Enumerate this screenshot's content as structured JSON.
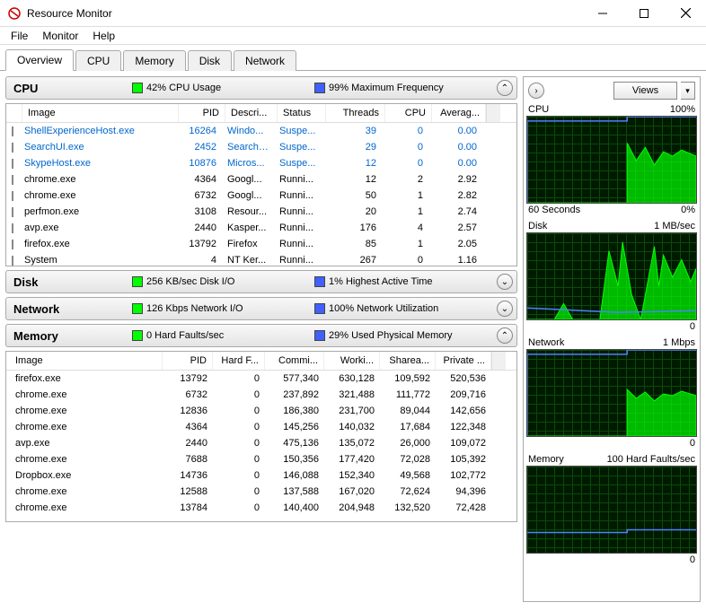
{
  "window": {
    "title": "Resource Monitor"
  },
  "menu": [
    "File",
    "Monitor",
    "Help"
  ],
  "tabs": [
    "Overview",
    "CPU",
    "Memory",
    "Disk",
    "Network"
  ],
  "active_tab": 0,
  "sections": {
    "cpu": {
      "name": "CPU",
      "stat1": "42% CPU Usage",
      "stat2": "99% Maximum Frequency",
      "expanded": true,
      "headers": [
        "Image",
        "PID",
        "Descri...",
        "Status",
        "Threads",
        "CPU",
        "Averag..."
      ],
      "rows": [
        {
          "blue": true,
          "img": "ShellExperienceHost.exe",
          "pid": "16264",
          "desc": "Windo...",
          "status": "Suspe...",
          "threads": "39",
          "cpu": "0",
          "avg": "0.00"
        },
        {
          "blue": true,
          "img": "SearchUI.exe",
          "pid": "2452",
          "desc": "Search ...",
          "status": "Suspe...",
          "threads": "29",
          "cpu": "0",
          "avg": "0.00"
        },
        {
          "blue": true,
          "img": "SkypeHost.exe",
          "pid": "10876",
          "desc": "Micros...",
          "status": "Suspe...",
          "threads": "12",
          "cpu": "0",
          "avg": "0.00"
        },
        {
          "blue": false,
          "img": "chrome.exe",
          "pid": "4364",
          "desc": "Googl...",
          "status": "Runni...",
          "threads": "12",
          "cpu": "2",
          "avg": "2.92"
        },
        {
          "blue": false,
          "img": "chrome.exe",
          "pid": "6732",
          "desc": "Googl...",
          "status": "Runni...",
          "threads": "50",
          "cpu": "1",
          "avg": "2.82"
        },
        {
          "blue": false,
          "img": "perfmon.exe",
          "pid": "3108",
          "desc": "Resour...",
          "status": "Runni...",
          "threads": "20",
          "cpu": "1",
          "avg": "2.74"
        },
        {
          "blue": false,
          "img": "avp.exe",
          "pid": "2440",
          "desc": "Kasper...",
          "status": "Runni...",
          "threads": "176",
          "cpu": "4",
          "avg": "2.57"
        },
        {
          "blue": false,
          "img": "firefox.exe",
          "pid": "13792",
          "desc": "Firefox",
          "status": "Runni...",
          "threads": "85",
          "cpu": "1",
          "avg": "2.05"
        },
        {
          "blue": false,
          "img": "System",
          "pid": "4",
          "desc": "NT Ker...",
          "status": "Runni...",
          "threads": "267",
          "cpu": "0",
          "avg": "1.16"
        }
      ]
    },
    "disk": {
      "name": "Disk",
      "stat1": "256 KB/sec Disk I/O",
      "stat2": "1% Highest Active Time",
      "expanded": false
    },
    "network": {
      "name": "Network",
      "stat1": "126 Kbps Network I/O",
      "stat2": "100% Network Utilization",
      "expanded": false
    },
    "memory": {
      "name": "Memory",
      "stat1": "0 Hard Faults/sec",
      "stat2": "29% Used Physical Memory",
      "expanded": true,
      "headers": [
        "Image",
        "PID",
        "Hard F...",
        "Commi...",
        "Worki...",
        "Sharea...",
        "Private ..."
      ],
      "rows": [
        {
          "img": "firefox.exe",
          "pid": "13792",
          "hf": "0",
          "commit": "577,340",
          "work": "630,128",
          "share": "109,592",
          "priv": "520,536"
        },
        {
          "img": "chrome.exe",
          "pid": "6732",
          "hf": "0",
          "commit": "237,892",
          "work": "321,488",
          "share": "111,772",
          "priv": "209,716"
        },
        {
          "img": "chrome.exe",
          "pid": "12836",
          "hf": "0",
          "commit": "186,380",
          "work": "231,700",
          "share": "89,044",
          "priv": "142,656"
        },
        {
          "img": "chrome.exe",
          "pid": "4364",
          "hf": "0",
          "commit": "145,256",
          "work": "140,032",
          "share": "17,684",
          "priv": "122,348"
        },
        {
          "img": "avp.exe",
          "pid": "2440",
          "hf": "0",
          "commit": "475,136",
          "work": "135,072",
          "share": "26,000",
          "priv": "109,072"
        },
        {
          "img": "chrome.exe",
          "pid": "7688",
          "hf": "0",
          "commit": "150,356",
          "work": "177,420",
          "share": "72,028",
          "priv": "105,392"
        },
        {
          "img": "Dropbox.exe",
          "pid": "14736",
          "hf": "0",
          "commit": "146,088",
          "work": "152,340",
          "share": "49,568",
          "priv": "102,772"
        },
        {
          "img": "chrome.exe",
          "pid": "12588",
          "hf": "0",
          "commit": "137,588",
          "work": "167,020",
          "share": "72,624",
          "priv": "94,396"
        },
        {
          "img": "chrome.exe",
          "pid": "13784",
          "hf": "0",
          "commit": "140,400",
          "work": "204,948",
          "share": "132,520",
          "priv": "72,428"
        }
      ]
    }
  },
  "right_panel": {
    "views_label": "Views",
    "charts": [
      {
        "title": "CPU",
        "right": "100%",
        "footer_left": "60 Seconds",
        "footer_right": "0%"
      },
      {
        "title": "Disk",
        "right": "1 MB/sec",
        "footer_left": "",
        "footer_right": "0"
      },
      {
        "title": "Network",
        "right": "1 Mbps",
        "footer_left": "",
        "footer_right": "0"
      },
      {
        "title": "Memory",
        "right": "100 Hard Faults/sec",
        "footer_left": "",
        "footer_right": "0"
      }
    ]
  },
  "chevrons": {
    "up": "⌃",
    "down": "⌄",
    "right": "›",
    "dropdown": "▾"
  }
}
